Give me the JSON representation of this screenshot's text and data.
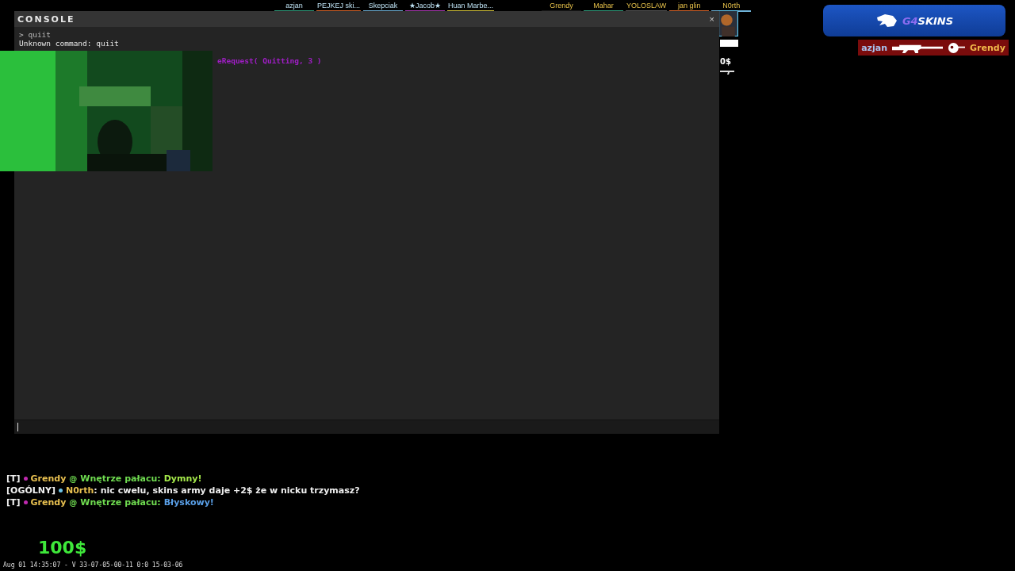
{
  "scoreboard": {
    "left": [
      {
        "name": "azjan",
        "color": "#2f9e7e"
      },
      {
        "name": "PEJKEJ ski...",
        "color": "#d9662a"
      },
      {
        "name": "Skepciak",
        "color": "#6fb3d9"
      },
      {
        "name": "★Jacob★",
        "color": "#b03ab8"
      },
      {
        "name": "Huan Marbe...",
        "color": "#d6c43a"
      }
    ],
    "right": [
      {
        "name": "Grendy",
        "color": "#1a1a1a"
      },
      {
        "name": "Mahar",
        "color": "#2f9e7e"
      },
      {
        "name": "YOLOSLAW",
        "color": "#555555"
      },
      {
        "name": "jan glin",
        "color": "#d9662a"
      },
      {
        "name": "N0rth",
        "color": "#6fb3d9"
      }
    ]
  },
  "console": {
    "title": "CONSOLE",
    "close": "×",
    "lines": [
      {
        "text": "> quiit",
        "kind": "input"
      },
      {
        "text": "Unknown command: quiit",
        "kind": "output"
      },
      {
        "text": "eRequest( Quitting, 3 )",
        "kind": "error"
      }
    ]
  },
  "side_hud": {
    "money": "0$"
  },
  "sponsor": {
    "brand_prefix": "G4",
    "brand_suffix": "SKINS"
  },
  "killfeed": [
    {
      "attacker": "azjan",
      "victim": "Grendy",
      "headshot": true
    }
  ],
  "chat": [
    {
      "channel": "[T]",
      "color": "#c02ab0",
      "name": "Grendy",
      "at": "@",
      "location": "Wnętrze pałacu",
      "separator": ":",
      "message": "Dymny!",
      "kind": "radio"
    },
    {
      "channel": "[OGÓLNY]",
      "color": "#6fc4e8",
      "name": "N0rth",
      "separator": ":",
      "message": "nic cwelu, skins army daje +2$ że w nicku trzymasz?",
      "kind": "text"
    },
    {
      "channel": "[T]",
      "color": "#c02ab0",
      "name": "Grendy",
      "at": "@",
      "location": "Wnętrze pałacu",
      "separator": ":",
      "message": "Błyskowy!",
      "kind": "radio"
    }
  ],
  "money": "100$",
  "build_info": "Aug 01 14:35:07 - V 33-07-05-00-11 0:0 15-03-06"
}
